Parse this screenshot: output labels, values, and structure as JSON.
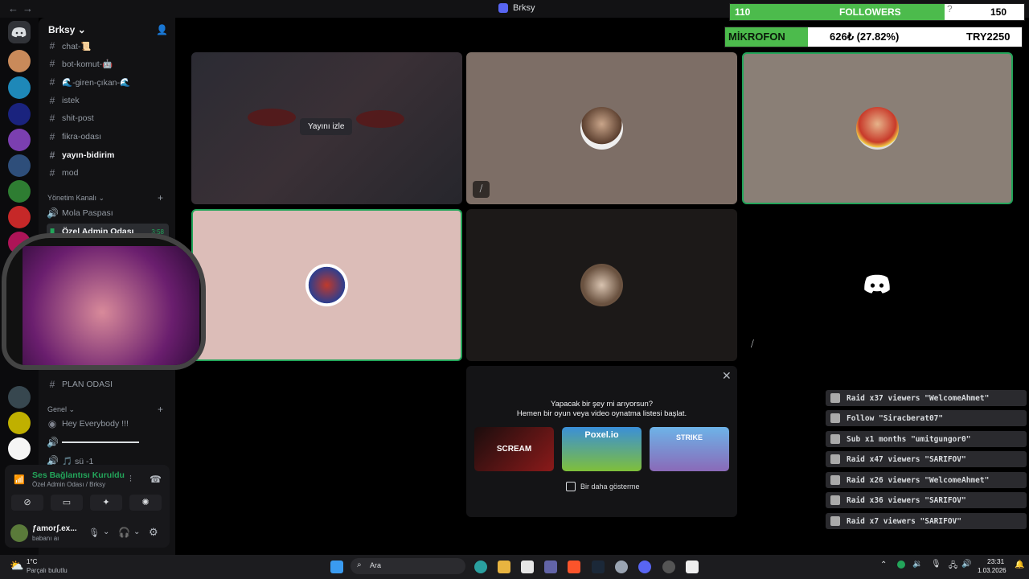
{
  "window": {
    "title": "Brksy"
  },
  "server": {
    "name": "Brksy"
  },
  "channels": [
    {
      "label": "chat-📜"
    },
    {
      "label": "bot-komut-🤖"
    },
    {
      "label": "🌊-giren-çıkan-🌊"
    },
    {
      "label": "istek"
    },
    {
      "label": "shit-post"
    },
    {
      "label": "fikra-odası"
    },
    {
      "label": "yayın-bidirim"
    },
    {
      "label": "mod"
    }
  ],
  "categories": {
    "yonetim": "Yönetim Kanalı",
    "genel": "Genel"
  },
  "voice_channels": {
    "mola": "Mola Paspası",
    "ozel": "Özel Admin Odası",
    "ozel_time": "3:58",
    "plan": "PLAN ODASI",
    "hey": "Hey Everybody !!!",
    "su": "🎵 sü -1"
  },
  "voice_status": {
    "title": "Ses Bağlantısı Kuruldu",
    "subtitle": "Özel Admin Odası / Brksy"
  },
  "user": {
    "name": "ƒamorʃ.ex...",
    "status": "babanı aı"
  },
  "stage": {
    "watch_label": "Yayını izle",
    "activity_title": "Yapacak bir şey mi arıyorsun?",
    "activity_sub": "Hemen bir oyun veya video oynatma listesi başlat.",
    "checkbox_label": "Bir daha gösterme",
    "games": [
      {
        "name": "SCREAM",
        "color": "#8b1a1a"
      },
      {
        "name": "Poxel.io",
        "color": "#3a8fd8"
      },
      {
        "name": "STRIKE",
        "color": "#6db3e8"
      }
    ]
  },
  "overlay": {
    "followers_count": "110",
    "followers_label": "FOLLOWERS",
    "followers_goal": "150",
    "followers_progress": 0.73,
    "mic_label": "MİKROFON",
    "mic_amount": "626₺ (27.82%)",
    "mic_goal": "TRY2250",
    "mic_progress": 0.2782
  },
  "feed": [
    {
      "text": "Raid x37 viewers \"WelcomeAhmet\"",
      "icon": "raid-icon"
    },
    {
      "text": "Follow \"Siracberat07\"",
      "icon": "heart-icon"
    },
    {
      "text": "Sub x1 months \"umitgungor0\"",
      "icon": "star-icon"
    },
    {
      "text": "Raid x47 viewers \"SARIFOV\"",
      "icon": "raid-icon"
    },
    {
      "text": "Raid x26 viewers \"WelcomeAhmet\"",
      "icon": "raid-icon"
    },
    {
      "text": "Raid x36 viewers \"SARIFOV\"",
      "icon": "raid-icon"
    },
    {
      "text": "Raid x7 viewers \"SARIFOV\"",
      "icon": "raid-icon"
    }
  ],
  "taskbar": {
    "weather_temp": "1°C",
    "weather_desc": "Parçalı bulutlu",
    "search_placeholder": "Ara",
    "time": "23:31",
    "date": "1.03.2026"
  },
  "colors": {
    "accent_green": "#23a55a",
    "discord_blurple": "#5865f2",
    "progress_green": "#4cbb4c"
  }
}
